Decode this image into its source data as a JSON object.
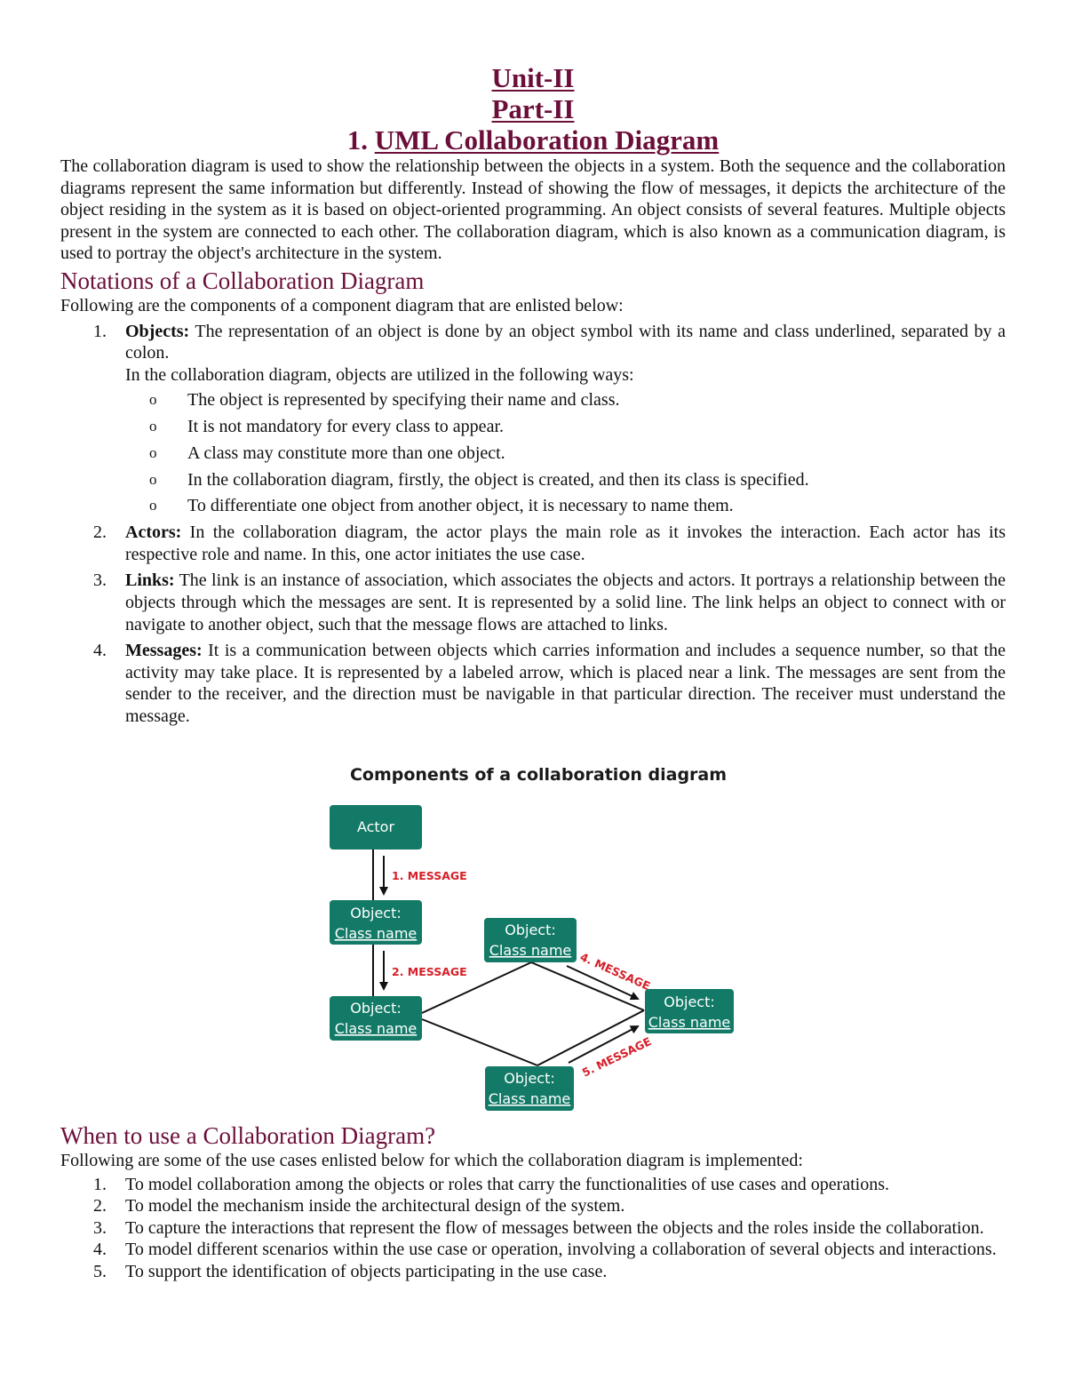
{
  "header": {
    "unit": "Unit-II",
    "part": "Part-II",
    "section_number": "1.",
    "section_title": "UML Collaboration Diagram"
  },
  "intro": "The collaboration diagram is used to show the relationship between the objects in a system. Both the sequence and the collaboration diagrams represent the same information but differently. Instead of showing the flow of messages, it depicts the architecture of the object residing in the system as it is based on object-oriented programming. An object consists of several features. Multiple objects present in the system are connected to each other. The collaboration diagram, which is also known as a communication diagram, is used to portray the object's architecture in the system.",
  "notations": {
    "heading": "Notations of a Collaboration Diagram",
    "lead": "Following are the components of a component diagram that are enlisted below:",
    "items": [
      {
        "num": "1.",
        "term": "Objects:",
        "text": " The representation of an object is done by an object symbol with its name and class underlined, separated by a colon.",
        "extra": "In the collaboration diagram, objects are utilized in the following ways:",
        "bullet_glyph": "o",
        "bullets": [
          "The object is represented by specifying their name and class.",
          "It is not mandatory for every class to appear.",
          "A class may constitute more than one object.",
          "In the collaboration diagram, firstly, the object is created, and then its class is specified.",
          "To differentiate one object from another object, it is necessary to name them."
        ]
      },
      {
        "num": "2.",
        "term": "Actors:",
        "text": " In the collaboration diagram, the actor plays the main role as it invokes the interaction. Each actor has its respective role and name. In this, one actor initiates the use case."
      },
      {
        "num": "3.",
        "term": "Links:",
        "text": " The link is an instance of association, which associates the objects and actors. It portrays a relationship between the objects through which the messages are sent. It is represented by a solid line. The link helps an object to connect with or navigate to another object, such that the message flows are attached to links."
      },
      {
        "num": "4.",
        "term": "Messages:",
        "text": " It is a communication between objects which carries information and includes a sequence number, so that the activity may take place. It is represented by a labeled arrow, which is placed near a link. The messages are sent from the sender to the receiver, and the direction must be navigable in that particular direction. The receiver must understand the message."
      }
    ]
  },
  "figure": {
    "title": "Components of a collaboration diagram",
    "box_color": "#127a66",
    "message_color": "#d6202a",
    "actor_label": "Actor",
    "object_line1": "Object:",
    "object_line2": "Class name",
    "messages": [
      "1. MESSAGE",
      "2. MESSAGE",
      "4. MESSAGE",
      "5. MESSAGE"
    ]
  },
  "uses": {
    "heading": "When to use a Collaboration Diagram?",
    "lead": "Following are some of the use cases enlisted below for which the collaboration diagram is implemented:",
    "items": [
      {
        "num": "1.",
        "text": "To model collaboration among the objects or roles that carry the functionalities of use cases and operations."
      },
      {
        "num": "2.",
        "text": "To model the mechanism inside the architectural design of the system."
      },
      {
        "num": "3.",
        "text": "To capture the interactions that represent the flow of messages between the objects and the roles inside the collaboration."
      },
      {
        "num": "4.",
        "text": "To model different scenarios within the use case or operation, involving a collaboration of several objects and interactions."
      },
      {
        "num": "5.",
        "text": "To support the identification of objects participating in the use case."
      }
    ]
  }
}
